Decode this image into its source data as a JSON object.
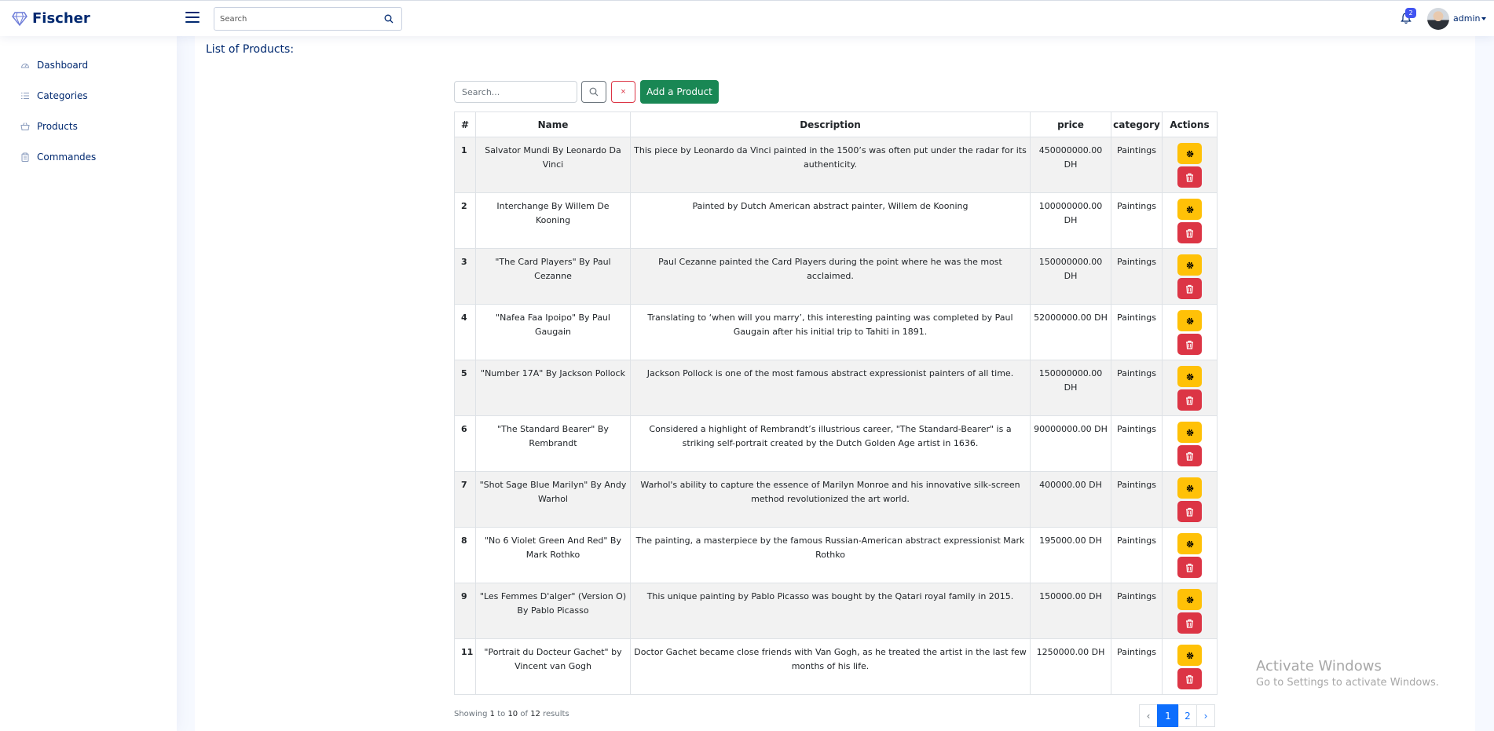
{
  "app": {
    "name": "Fischer"
  },
  "header": {
    "search_placeholder": "Search",
    "notifications_count": "2",
    "user_name": "admin"
  },
  "sidebar": {
    "items": [
      {
        "label": "Dashboard",
        "icon": "speedometer-icon"
      },
      {
        "label": "Categories",
        "icon": "list-icon"
      },
      {
        "label": "Products",
        "icon": "basket-icon"
      },
      {
        "label": "Commandes",
        "icon": "clipboard-icon"
      }
    ]
  },
  "page": {
    "title": "List of Products:"
  },
  "toolbar": {
    "search_placeholder": "Search...",
    "clear_label": "×",
    "add_label": "Add a Product"
  },
  "table": {
    "headers": [
      "#",
      "Name",
      "Description",
      "price",
      "category",
      "Actions"
    ],
    "rows": [
      {
        "id": "1",
        "name": "Salvator Mundi By Leonardo Da Vinci",
        "description": "This piece by Leonardo da Vinci painted in the 1500’s was often put under the radar for its authenticity.",
        "price": "450000000.00 DH",
        "category": "Paintings"
      },
      {
        "id": "2",
        "name": "Interchange By Willem De Kooning",
        "description": "Painted by Dutch American abstract painter, Willem de Kooning",
        "price": "100000000.00 DH",
        "category": "Paintings"
      },
      {
        "id": "3",
        "name": "\"The Card Players\" By Paul Cezanne",
        "description": "Paul Cezanne painted the Card Players during the point where he was the most acclaimed.",
        "price": "150000000.00 DH",
        "category": "Paintings"
      },
      {
        "id": "4",
        "name": "\"Nafea Faa Ipoipo\" By Paul Gaugain",
        "description": "Translating to ‘when will you marry’, this interesting painting was completed by Paul Gaugain after his initial trip to Tahiti in 1891.",
        "price": "52000000.00 DH",
        "category": "Paintings"
      },
      {
        "id": "5",
        "name": "\"Number 17A\" By Jackson Pollock",
        "description": "Jackson Pollock is one of the most famous abstract expressionist painters of all time.",
        "price": "150000000.00 DH",
        "category": "Paintings"
      },
      {
        "id": "6",
        "name": "\"The Standard Bearer\" By Rembrandt",
        "description": "Considered a highlight of Rembrandt’s illustrious career, \"The Standard-Bearer\" is a striking self-portrait created by the Dutch Golden Age artist in 1636.",
        "price": "90000000.00 DH",
        "category": "Paintings"
      },
      {
        "id": "7",
        "name": "\"Shot Sage Blue Marilyn\" By Andy Warhol",
        "description": "Warhol's ability to capture the essence of Marilyn Monroe and his innovative silk-screen method revolutionized the art world.",
        "price": "400000.00 DH",
        "category": "Paintings"
      },
      {
        "id": "8",
        "name": "\"No 6 Violet Green And Red\" By Mark Rothko",
        "description": "The painting, a masterpiece by the famous Russian-American abstract expressionist Mark Rothko",
        "price": "195000.00 DH",
        "category": "Paintings"
      },
      {
        "id": "9",
        "name": "\"Les Femmes D'alger\" (Version O) By Pablo Picasso",
        "description": "This unique painting by Pablo Picasso was bought by the Qatari royal family in 2015.",
        "price": "150000.00 DH",
        "category": "Paintings"
      },
      {
        "id": "11",
        "name": "\"Portrait du Docteur Gachet\" by Vincent van Gogh",
        "description": "Doctor Gachet became close friends with Van Gogh, as he treated the artist in the last few months of his life.",
        "price": "1250000.00 DH",
        "category": "Paintings"
      }
    ]
  },
  "footer": {
    "showing_prefix": "Showing",
    "from": "1",
    "to_word": "to",
    "to": "10",
    "of_word": "of",
    "total": "12",
    "suffix": "results",
    "pages": [
      "1",
      "2"
    ],
    "prev": "‹",
    "next": "›"
  },
  "watermark": {
    "title": "Activate Windows",
    "subtitle": "Go to Settings to activate Windows."
  },
  "colors": {
    "brand": "#012970",
    "add_button": "#198754",
    "edit_button": "#ffc107",
    "delete_button": "#dc3545",
    "active_page": "#0d6efd"
  }
}
